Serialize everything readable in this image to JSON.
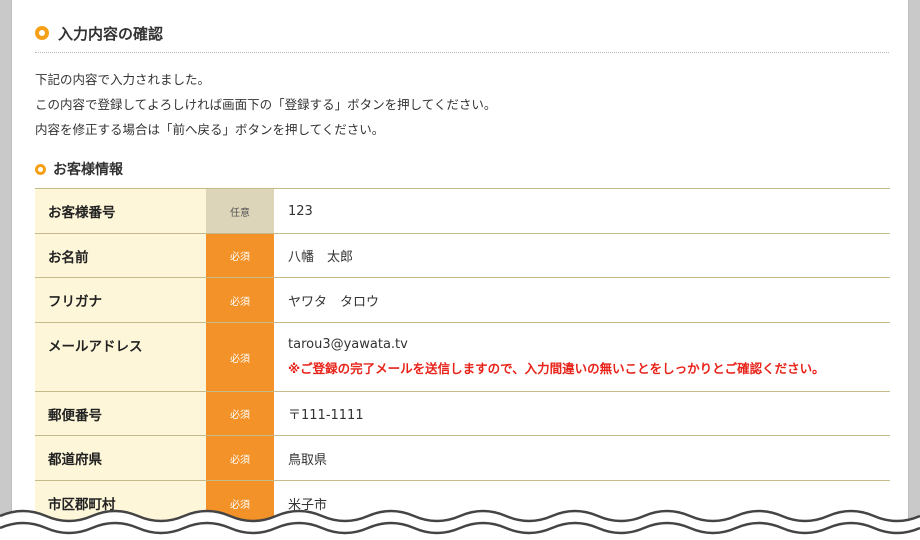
{
  "section": {
    "title": "入力内容の確認"
  },
  "intro": {
    "line1": "下記の内容で入力されました。",
    "line2": "この内容で登録してよろしければ画面下の「登録する」ボタンを押してください。",
    "line3": "内容を修正する場合は「前へ戻る」ボタンを押してください。"
  },
  "subsection": {
    "title": "お客様情報"
  },
  "rows": [
    {
      "label": "お客様番号",
      "badge": "任意",
      "value": "123"
    },
    {
      "label": "お名前",
      "badge": "必須",
      "value": "八幡　太郎"
    },
    {
      "label": "フリガナ",
      "badge": "必須",
      "value": "ヤワタ　タロウ"
    },
    {
      "label": "メールアドレス",
      "badge": "必須",
      "value": "tarou3@yawata.tv",
      "note": "※ご登録の完了メールを送信しますので、入力間違いの無いことをしっかりとご確認ください。"
    },
    {
      "label": "郵便番号",
      "badge": "必須",
      "value": "〒111-1111"
    },
    {
      "label": "都道府県",
      "badge": "必須",
      "value": "鳥取県"
    },
    {
      "label": "市区郡町村",
      "badge": "必須",
      "value": "米子市"
    }
  ],
  "colors": {
    "accent": "#f6a017",
    "required_badge": "#f29228",
    "optional_badge": "#ddd5b9",
    "label_bg": "#fdf6d9",
    "note": "#e8231a"
  },
  "icons": {
    "section": "ring-icon",
    "subsection": "ring-icon"
  }
}
